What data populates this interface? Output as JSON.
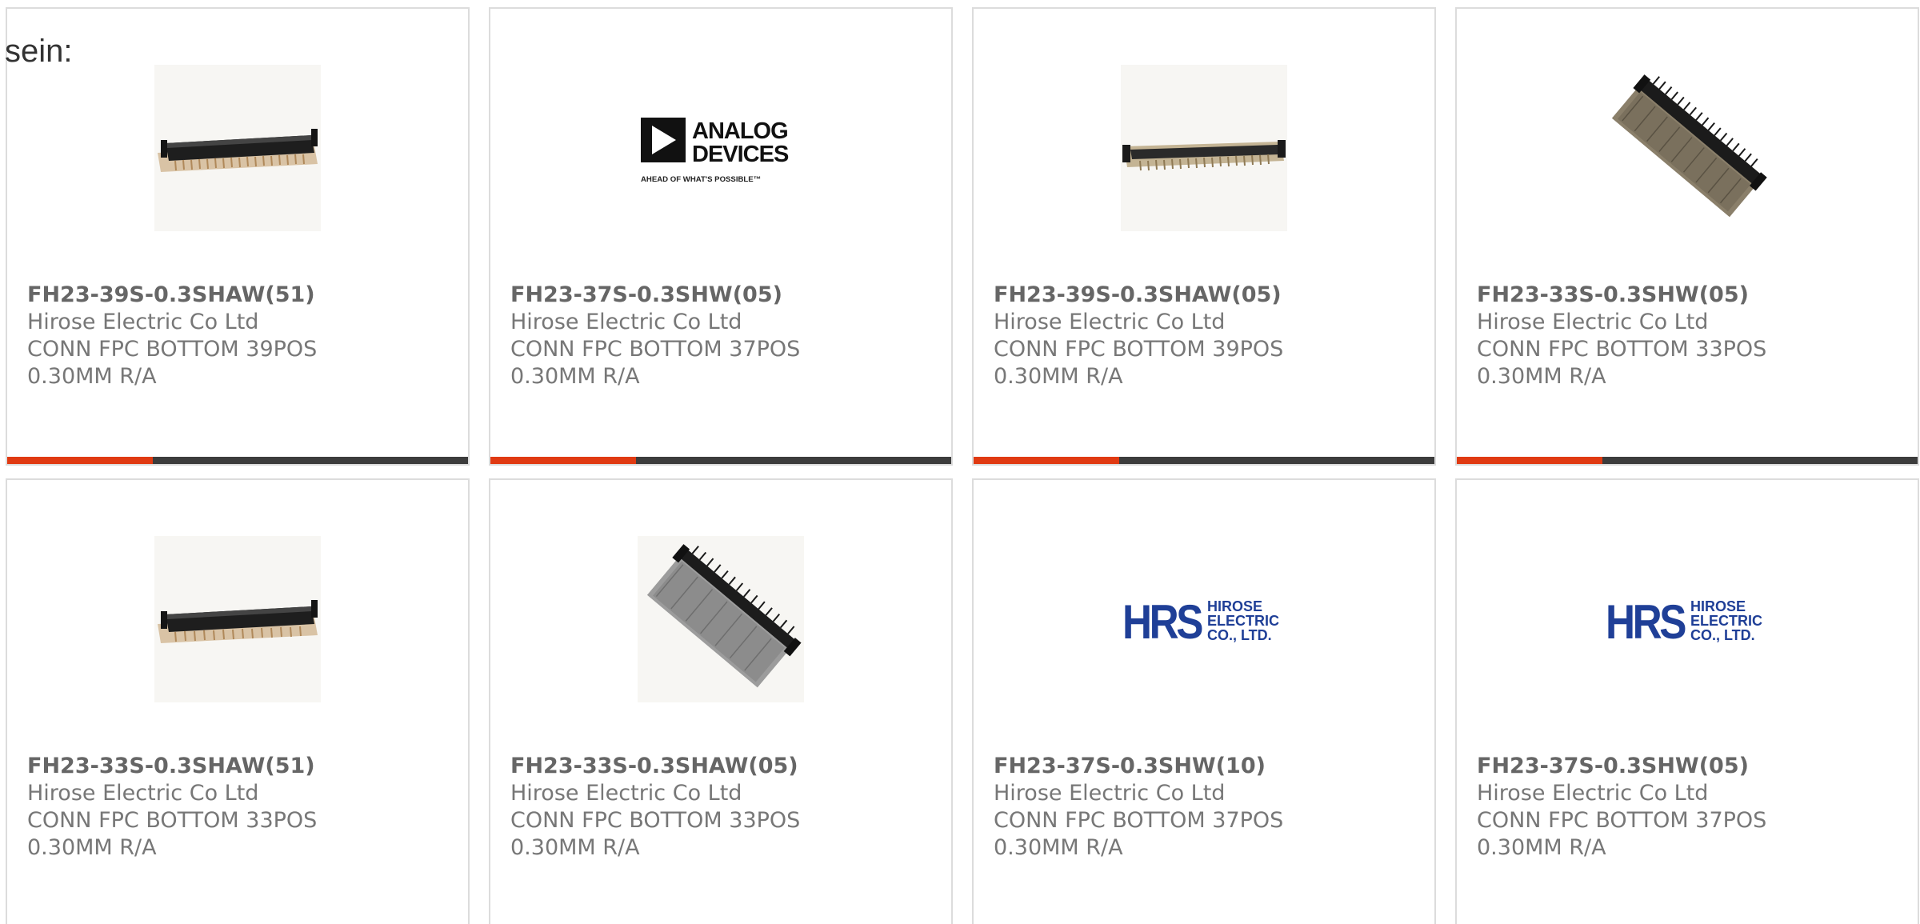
{
  "intro_text": "sein:",
  "colors": {
    "accent_bar": "#e03a12",
    "dark_bar": "#3c3c3c",
    "hrs_blue": "#1f3f97"
  },
  "products": [
    {
      "part_number": "FH23-39S-0.3SHAW(51)",
      "manufacturer": "Hirose Electric Co Ltd",
      "description_line1": "CONN FPC BOTTOM 39POS",
      "description_line2": "0.30MM R/A",
      "image": "fpc-connector-flat-dark-icon"
    },
    {
      "part_number": "FH23-37S-0.3SHW(05)",
      "manufacturer": "Hirose Electric Co Ltd",
      "description_line1": "CONN FPC BOTTOM 37POS",
      "description_line2": "0.30MM R/A",
      "image": "analog-devices-logo",
      "logo": {
        "line1": "ANALOG",
        "line2": "DEVICES",
        "tagline": "AHEAD OF WHAT'S POSSIBLE™"
      }
    },
    {
      "part_number": "FH23-39S-0.3SHAW(05)",
      "manufacturer": "Hirose Electric Co Ltd",
      "description_line1": "CONN FPC BOTTOM 39POS",
      "description_line2": "0.30MM R/A",
      "image": "fpc-connector-flat-beige-icon"
    },
    {
      "part_number": "FH23-33S-0.3SHW(05)",
      "manufacturer": "Hirose Electric Co Ltd",
      "description_line1": "CONN FPC BOTTOM 33POS",
      "description_line2": "0.30MM R/A",
      "image": "fpc-connector-angled-icon"
    },
    {
      "part_number": "FH23-33S-0.3SHAW(51)",
      "manufacturer": "Hirose Electric Co Ltd",
      "description_line1": "CONN FPC BOTTOM 33POS",
      "description_line2": "0.30MM R/A",
      "image": "fpc-connector-flat-dark-icon"
    },
    {
      "part_number": "FH23-33S-0.3SHAW(05)",
      "manufacturer": "Hirose Electric Co Ltd",
      "description_line1": "CONN FPC BOTTOM 33POS",
      "description_line2": "0.30MM R/A",
      "image": "fpc-connector-angled-grey-icon"
    },
    {
      "part_number": "FH23-37S-0.3SHW(10)",
      "manufacturer": "Hirose Electric Co Ltd",
      "description_line1": "CONN FPC BOTTOM 37POS",
      "description_line2": "0.30MM R/A",
      "image": "hirose-logo",
      "logo": {
        "mark": "HRS",
        "line1": "HIROSE",
        "line2": "ELECTRIC",
        "line3": "CO., LTD."
      }
    },
    {
      "part_number": "FH23-37S-0.3SHW(05)",
      "manufacturer": "Hirose Electric Co Ltd",
      "description_line1": "CONN FPC BOTTOM 37POS",
      "description_line2": "0.30MM R/A",
      "image": "hirose-logo",
      "logo": {
        "mark": "HRS",
        "line1": "HIROSE",
        "line2": "ELECTRIC",
        "line3": "CO., LTD."
      }
    }
  ]
}
